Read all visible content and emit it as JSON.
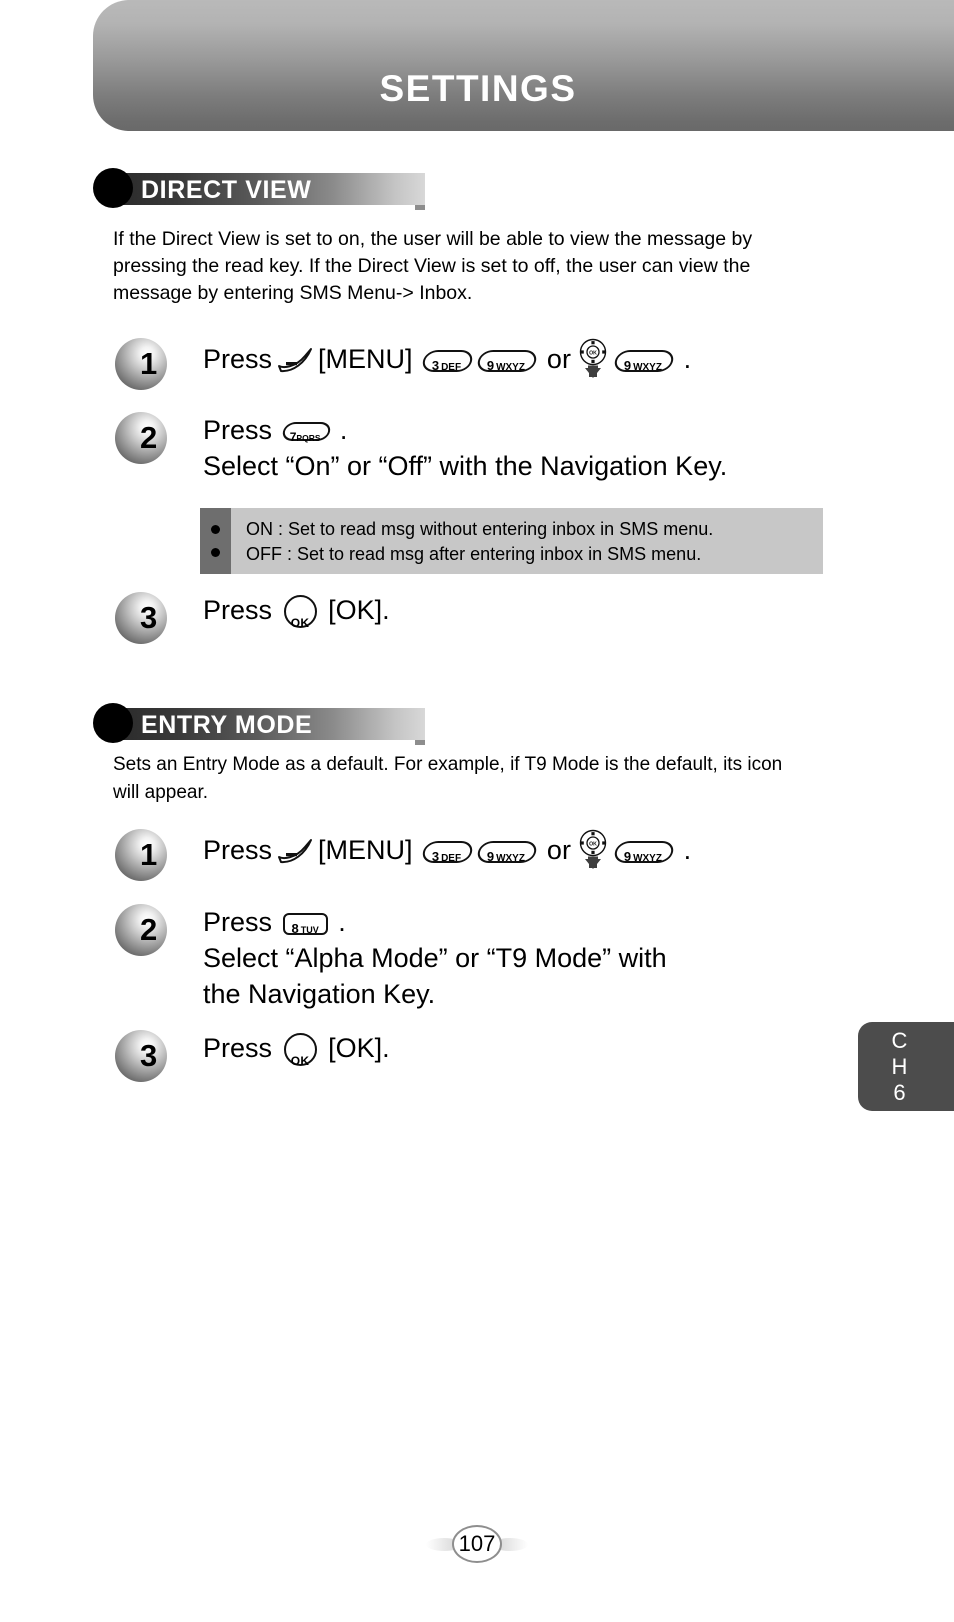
{
  "header": {
    "title": "SETTINGS"
  },
  "sections": [
    {
      "id": "direct-view",
      "label": "DIRECT VIEW",
      "description": "If the Direct View is set to on, the user will be able to view the message by pressing the read key. If the Direct View is set to off, the user can view the message by entering SMS Menu-> Inbox.",
      "steps": [
        {
          "number": "1",
          "press_label": "Press",
          "menu_label": "[MENU]",
          "or_label": "or",
          "period": ".",
          "keys": [
            "3 DEF",
            "9 WXYZ",
            "9 WXYZ"
          ],
          "icons": [
            "softkey-icon",
            "navigation-key-icon"
          ]
        },
        {
          "number": "2",
          "press_label": "Press",
          "key": "7 PQRS",
          "period": ".",
          "line2": "Select “On” or “Off” with the Navigation Key."
        },
        {
          "number": "3",
          "press_label": "Press",
          "ok_key": "OK",
          "ok_label": "[OK]."
        }
      ],
      "info_box": {
        "lines": [
          "ON : Set to read msg without entering inbox in SMS menu.",
          "OFF : Set to read msg after entering inbox in SMS menu."
        ]
      }
    },
    {
      "id": "entry-mode",
      "label": "ENTRY MODE",
      "description": "Sets an Entry Mode as a default. For example, if T9 Mode is the default, its icon will appear.",
      "steps": [
        {
          "number": "1",
          "press_label": "Press",
          "menu_label": "[MENU]",
          "or_label": "or",
          "period": ".",
          "keys": [
            "3 DEF",
            "9 WXYZ",
            "9 WXYZ"
          ]
        },
        {
          "number": "2",
          "press_label": "Press",
          "key": "8 TUV",
          "period": ".",
          "line2": "Select  “Alpha Mode” or “T9 Mode” with",
          "line3": "the Navigation Key."
        },
        {
          "number": "3",
          "press_label": "Press",
          "ok_key": "OK",
          "ok_label": "[OK]."
        }
      ]
    }
  ],
  "keys": {
    "k3_digit": "3",
    "k3_letters": "DEF",
    "k9_digit": "9",
    "k9_letters": "WXYZ",
    "k7_digit": "7",
    "k7_letters": "PQRS",
    "k8_digit": "8",
    "k8_letters": "TUV",
    "ok_text": "OK",
    "nav_ok_text": "OK"
  },
  "side_tab": {
    "line1": "C",
    "line2": "H",
    "line3": "6"
  },
  "footer": {
    "page_number": "107"
  },
  "colors": {
    "header_gradient_top": "#b9b9b9",
    "header_gradient_bottom": "#696969",
    "section_bar_dark": "#2b2b2b",
    "section_bar_light": "#d8d8d8",
    "info_strip": "#6e6e6e",
    "info_body": "#c7c7c7",
    "side_tab": "#4c4c4c"
  }
}
